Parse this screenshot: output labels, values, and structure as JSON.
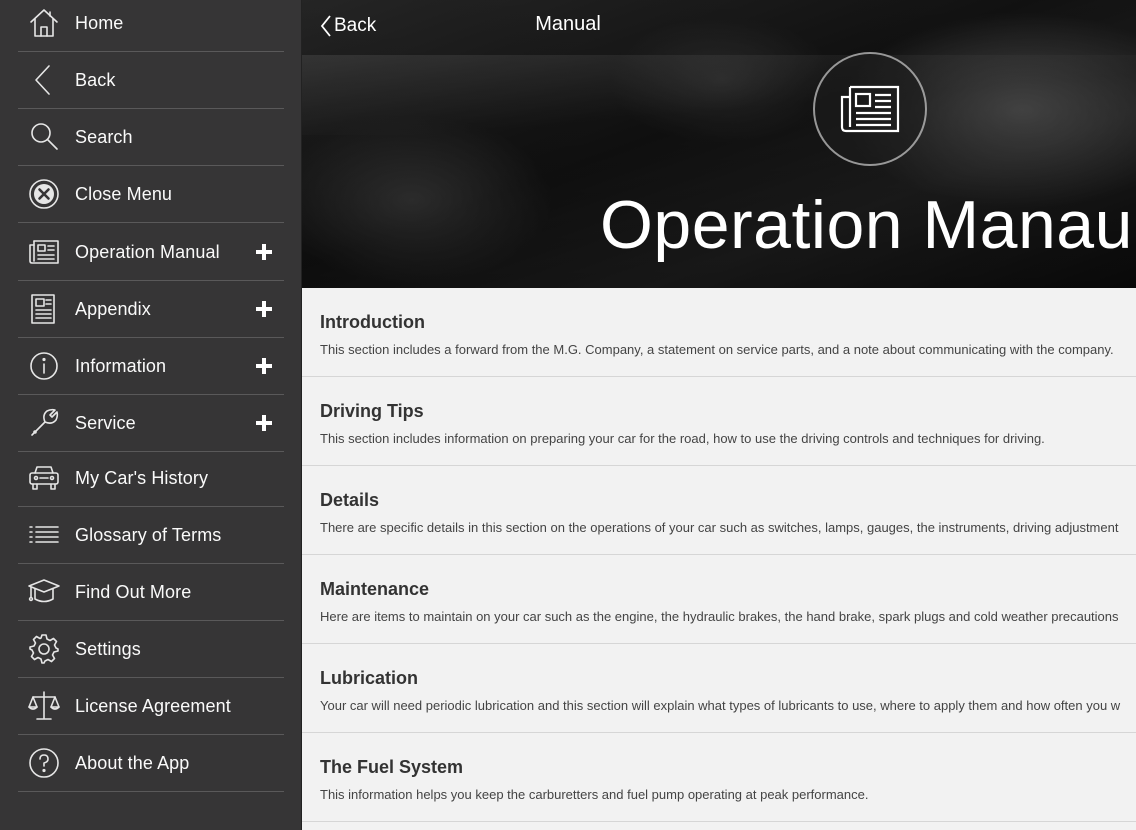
{
  "sidebar": {
    "items": [
      {
        "label": "Home",
        "icon": "home-icon",
        "expandable": false
      },
      {
        "label": "Back",
        "icon": "chevron-left-icon",
        "expandable": false
      },
      {
        "label": "Search",
        "icon": "search-icon",
        "expandable": false
      },
      {
        "label": "Close Menu",
        "icon": "close-circle-icon",
        "expandable": false
      },
      {
        "label": "Operation Manual",
        "icon": "newspaper-icon",
        "expandable": true
      },
      {
        "label": "Appendix",
        "icon": "document-icon",
        "expandable": true
      },
      {
        "label": "Information",
        "icon": "info-icon",
        "expandable": true
      },
      {
        "label": "Service",
        "icon": "wrench-icon",
        "expandable": true
      },
      {
        "label": "My Car's History",
        "icon": "car-icon",
        "expandable": false
      },
      {
        "label": "Glossary of Terms",
        "icon": "list-icon",
        "expandable": false
      },
      {
        "label": "Find Out More",
        "icon": "graduation-cap-icon",
        "expandable": false
      },
      {
        "label": "Settings",
        "icon": "gear-icon",
        "expandable": false
      },
      {
        "label": "License Agreement",
        "icon": "scales-icon",
        "expandable": false
      },
      {
        "label": "About the App",
        "icon": "question-icon",
        "expandable": false
      }
    ]
  },
  "header": {
    "back_label": "Back",
    "title": "Manual",
    "hero_title": "Operation Manaul",
    "hero_icon": "newspaper-icon"
  },
  "sections": [
    {
      "title": "Introduction",
      "description": "This section includes a forward from the M.G. Company, a statement on service parts, and a note about communicating with the company."
    },
    {
      "title": "Driving Tips",
      "description": "This section includes information on preparing your car for the road, how to use the driving controls and techniques for driving."
    },
    {
      "title": "Details",
      "description": "There are specific details in this section on the operations of your car such as switches, lamps, gauges, the instruments, driving adjustment"
    },
    {
      "title": "Maintenance",
      "description": "Here are items to maintain on your car such as the engine, the hydraulic brakes, the hand brake, spark plugs and cold weather precautions"
    },
    {
      "title": "Lubrication",
      "description": "Your car will need periodic lubrication and this section will explain what types of lubricants to use, where to apply them and how often you w"
    },
    {
      "title": "The Fuel System",
      "description": "This information helps you keep the carburetters and fuel pump operating at peak performance."
    }
  ],
  "colors": {
    "sidebar_bg": "#363536",
    "content_bg": "#f2f2f2",
    "text_primary": "#333333"
  }
}
